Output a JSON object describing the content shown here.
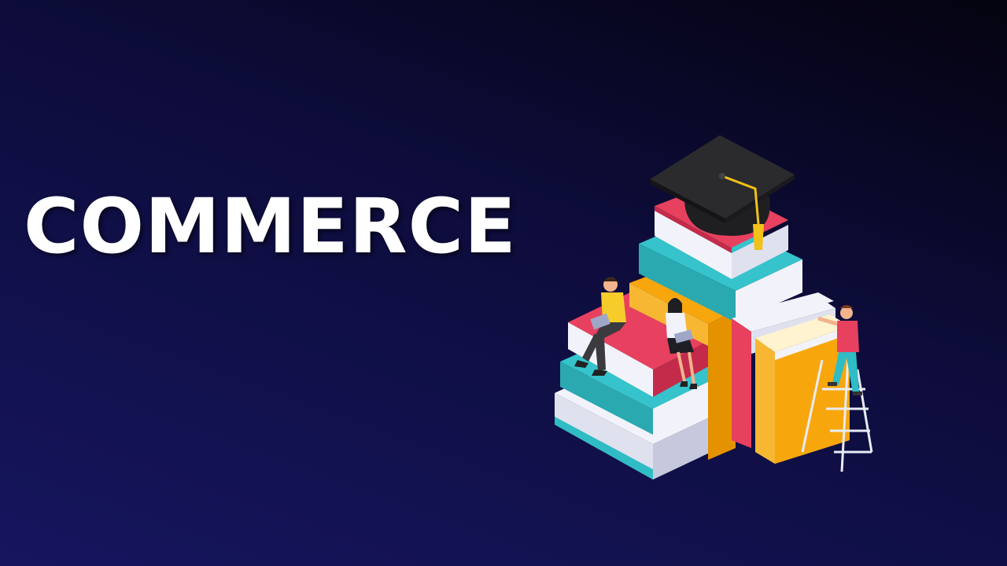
{
  "slide": {
    "title": "COMMERCE",
    "illustration": "books-graduation-cap-students-icon"
  },
  "colors": {
    "background_top": "#04030f",
    "background_bottom": "#16155f",
    "title": "#ffffff",
    "book_teal": "#2fbcc4",
    "book_red": "#e0325a",
    "book_orange": "#f7a70c",
    "book_pages": "#f2f3fa",
    "cap": "#222222",
    "tassel": "#f0c21a"
  }
}
